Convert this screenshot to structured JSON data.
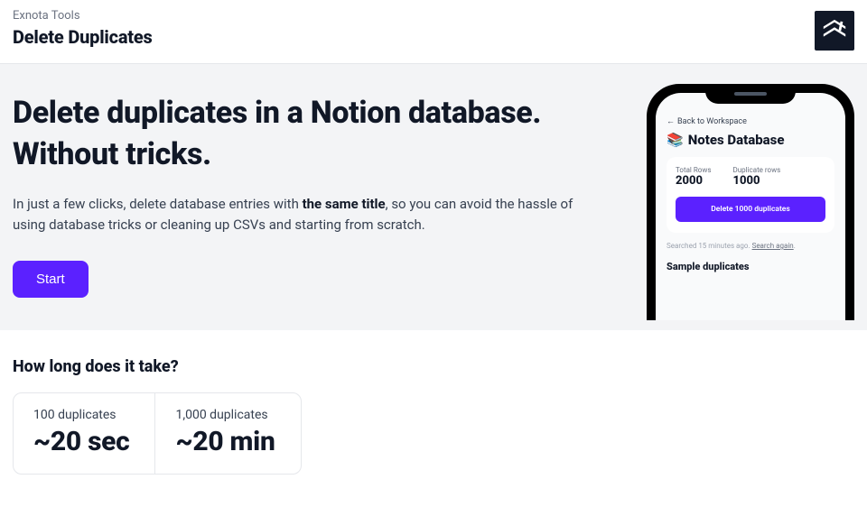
{
  "header": {
    "breadcrumb": "Exnota Tools",
    "title": "Delete Duplicates"
  },
  "hero": {
    "headline_line1": "Delete duplicates in a Notion database.",
    "headline_line2": "Without tricks.",
    "sub_before": "In just a few clicks, delete database entries with ",
    "sub_bold": "the same title",
    "sub_after": ", so you can avoid the hassle of using database tricks or cleaning up CSVs and starting from scratch.",
    "cta": "Start"
  },
  "phone": {
    "back_label": "Back to Workspace",
    "db_icon": "📚",
    "db_title": "Notes Database",
    "stats": {
      "total_label": "Total Rows",
      "total_value": "2000",
      "dup_label": "Duplicate rows",
      "dup_value": "1000"
    },
    "delete_btn": "Delete 1000 duplicates",
    "searched_text": "Searched 15 minutes ago. ",
    "search_again": "Search again",
    "sample_heading": "Sample duplicates"
  },
  "timing": {
    "heading": "How long does it take?",
    "cards": [
      {
        "label": "100 duplicates",
        "value": "~20 sec"
      },
      {
        "label": "1,000 duplicates",
        "value": "~20 min"
      }
    ]
  }
}
